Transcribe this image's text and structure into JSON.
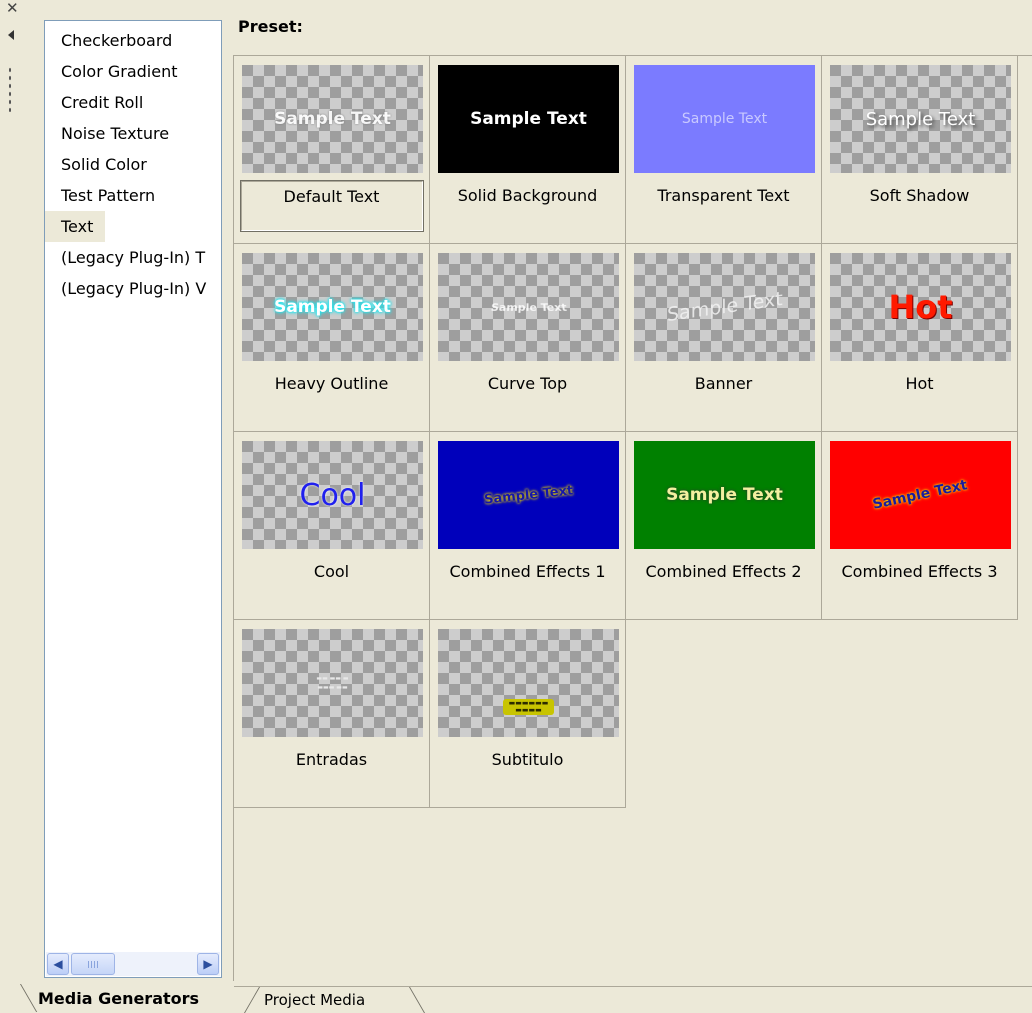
{
  "window": {
    "icons": {
      "close": "close-icon",
      "collapse": "triangle-left-icon",
      "grip": "grip-dots-icon"
    }
  },
  "plugins": {
    "items": [
      "Checkerboard",
      "Color Gradient",
      "Credit Roll",
      "Noise Texture",
      "Solid Color",
      "Test Pattern",
      "Text",
      "(Legacy Plug-In) T",
      "(Legacy Plug-In) V"
    ],
    "selected": "Text",
    "scrollbar": {
      "left_icon": "chevron-left-icon",
      "right_icon": "chevron-right-icon"
    }
  },
  "presets": {
    "label": "Preset:",
    "selected": "Default Text",
    "items": [
      {
        "name": "Default Text",
        "thumb_text": "Sample Text",
        "thumb_bg": "checker"
      },
      {
        "name": "Solid Background",
        "thumb_text": "Sample Text",
        "thumb_bg": "#000000"
      },
      {
        "name": "Transparent Text",
        "thumb_text": "Sample Text",
        "thumb_bg": "#7b7bff"
      },
      {
        "name": "Soft Shadow",
        "thumb_text": "Sample Text",
        "thumb_bg": "checker"
      },
      {
        "name": "Heavy Outline",
        "thumb_text": "Sample Text",
        "thumb_bg": "checker"
      },
      {
        "name": "Curve Top",
        "thumb_text": "Sample Text",
        "thumb_bg": "checker"
      },
      {
        "name": "Banner",
        "thumb_text": "Sample Text",
        "thumb_bg": "checker"
      },
      {
        "name": "Hot",
        "thumb_text": "Hot",
        "thumb_bg": "checker"
      },
      {
        "name": "Cool",
        "thumb_text": "Cool",
        "thumb_bg": "checker"
      },
      {
        "name": "Combined Effects 1",
        "thumb_text": "Sample Text",
        "thumb_bg": "#0000bb"
      },
      {
        "name": "Combined Effects 2",
        "thumb_text": "Sample Text",
        "thumb_bg": "#008000"
      },
      {
        "name": "Combined Effects 3",
        "thumb_text": "Sample Text",
        "thumb_bg": "#ff0000"
      },
      {
        "name": "Entradas",
        "thumb_text": "",
        "thumb_bg": "checker"
      },
      {
        "name": "Subtitulo",
        "thumb_text": "",
        "thumb_bg": "checker"
      }
    ]
  },
  "tabs": [
    {
      "label": "Media Generators",
      "active": true
    },
    {
      "label": "Project Media",
      "active": false
    }
  ]
}
